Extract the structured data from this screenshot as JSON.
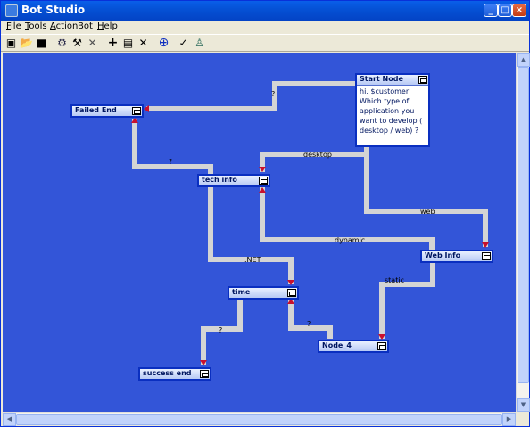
{
  "window": {
    "title": "Bot Studio"
  },
  "menu": [
    {
      "u": "F",
      "rest": "ile"
    },
    {
      "u": "T",
      "rest": "ools"
    },
    {
      "u": "A",
      "rest": "ction"
    },
    {
      "u": "",
      "rest": "Bot"
    },
    {
      "u": "H",
      "rest": "elp"
    }
  ],
  "toolbar": {
    "tools": [
      {
        "icon": "new-window-icon",
        "glyph": "▣"
      },
      {
        "icon": "open-folder-icon",
        "glyph": "📂"
      },
      {
        "icon": "save-disk-icon",
        "glyph": "■"
      },
      {
        "icon": "connect-nodes-icon",
        "glyph": "⚙"
      },
      {
        "icon": "tools-icon",
        "glyph": "⚒"
      },
      {
        "icon": "delete-x-icon",
        "glyph": "✕"
      },
      {
        "icon": "add-node-icon",
        "glyph": "+"
      },
      {
        "icon": "document-icon",
        "glyph": "▤"
      },
      {
        "icon": "remove-icon",
        "glyph": "✕"
      },
      {
        "icon": "add-circle-icon",
        "glyph": "⊕"
      },
      {
        "icon": "check-icon",
        "glyph": "✓"
      },
      {
        "icon": "user-icon",
        "glyph": "♙"
      }
    ]
  },
  "nodes": {
    "start": {
      "title": "Start Node",
      "body": "hi, $customer\nWhich type of application you want to develop ( desktop / web) ?"
    },
    "failed_end": {
      "title": "Failed End"
    },
    "tech_info": {
      "title": "tech info"
    },
    "web_info": {
      "title": "Web Info"
    },
    "time": {
      "title": "time"
    },
    "node_4": {
      "title": "Node_4"
    },
    "success_end": {
      "title": "success end"
    }
  },
  "connections": {
    "start_failed": "?",
    "failed_tech": "?",
    "start_tech": "desktop",
    "start_web": "web",
    "tech_dynamic": "dynamic",
    "tech_time": ".NET",
    "web_node4": "static",
    "time_node4": "?",
    "time_success": "?"
  },
  "colors": {
    "canvas": "#3355D8",
    "connector": "#D4D4D4",
    "arrow": "#C8102E",
    "titlebar": "#0552D6"
  }
}
